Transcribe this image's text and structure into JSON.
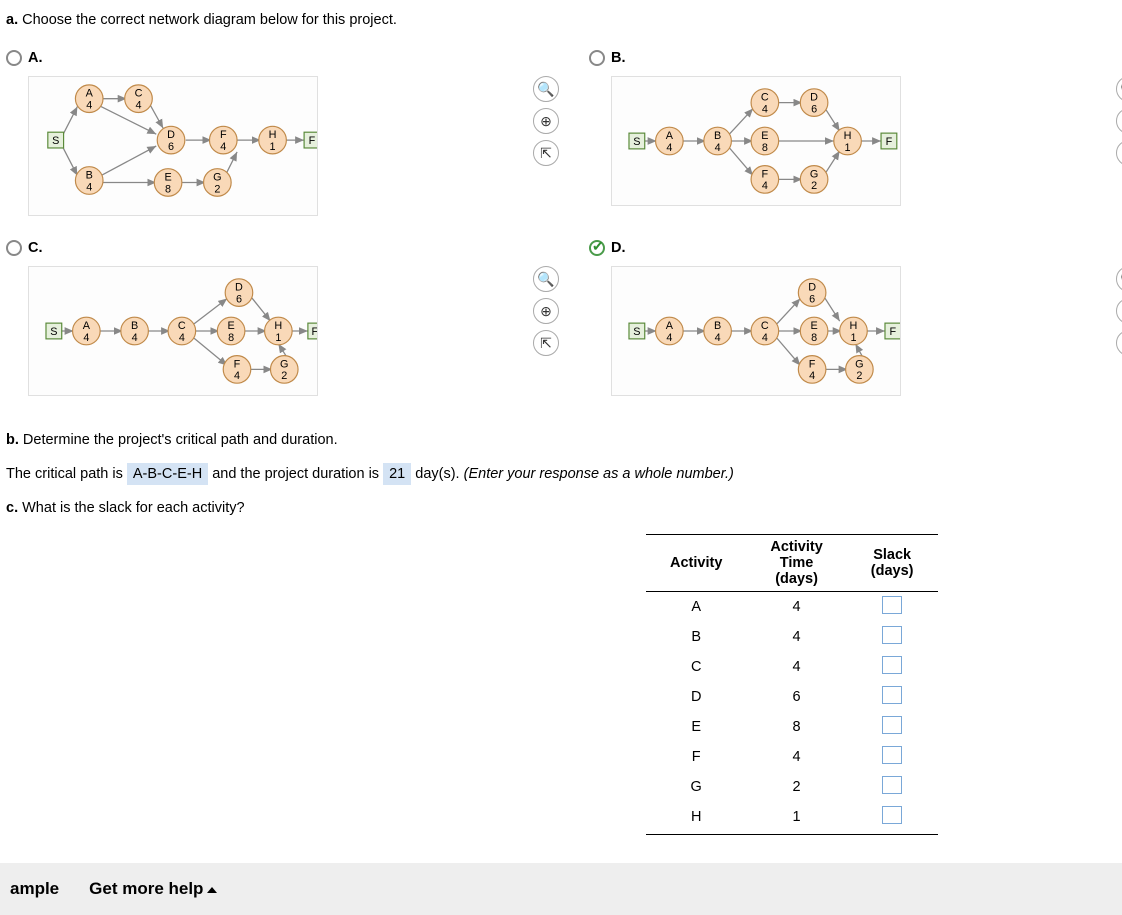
{
  "partA": {
    "prefix": "a.",
    "text": "Choose the correct network diagram below for this project.",
    "options": [
      {
        "id": "A",
        "label": "A.",
        "selected": false
      },
      {
        "id": "B",
        "label": "B.",
        "selected": false
      },
      {
        "id": "C",
        "label": "C.",
        "selected": false
      },
      {
        "id": "D",
        "label": "D.",
        "selected": true
      }
    ],
    "iconTitles": {
      "zoomIn": "Zoom in",
      "zoomReset": "Zoom",
      "open": "Open in new window"
    }
  },
  "partB": {
    "prefix": "b.",
    "text": "Determine the project's critical path and duration.",
    "line_pre": "The critical path is",
    "critical_path": "A-B-C-E-H",
    "line_mid": "and the project duration is",
    "duration": "21",
    "line_post": "day(s).",
    "hint": "(Enter your response as a whole number.)"
  },
  "partC": {
    "prefix": "c.",
    "text": "What is the slack for each activity?"
  },
  "table": {
    "h1": "Activity",
    "h2_l1": "Activity",
    "h2_l2": "Time",
    "h2_l3": "(days)",
    "h3_l1": "Slack",
    "h3_l2": "(days)",
    "rows": [
      {
        "act": "A",
        "time": "4"
      },
      {
        "act": "B",
        "time": "4"
      },
      {
        "act": "C",
        "time": "4"
      },
      {
        "act": "D",
        "time": "6"
      },
      {
        "act": "E",
        "time": "8"
      },
      {
        "act": "F",
        "time": "4"
      },
      {
        "act": "G",
        "time": "2"
      },
      {
        "act": "H",
        "time": "1"
      }
    ]
  },
  "nodes": {
    "A": {
      "l": "A",
      "d": "4"
    },
    "B": {
      "l": "B",
      "d": "4"
    },
    "C": {
      "l": "C",
      "d": "4"
    },
    "D": {
      "l": "D",
      "d": "6"
    },
    "E": {
      "l": "E",
      "d": "8"
    },
    "F": {
      "l": "F",
      "d": "4"
    },
    "G": {
      "l": "G",
      "d": "2"
    },
    "H": {
      "l": "H",
      "d": "1"
    },
    "S": {
      "l": "S"
    },
    "FX": {
      "l": "F"
    }
  },
  "footer": {
    "sample": "ample",
    "help": "Get more help"
  }
}
